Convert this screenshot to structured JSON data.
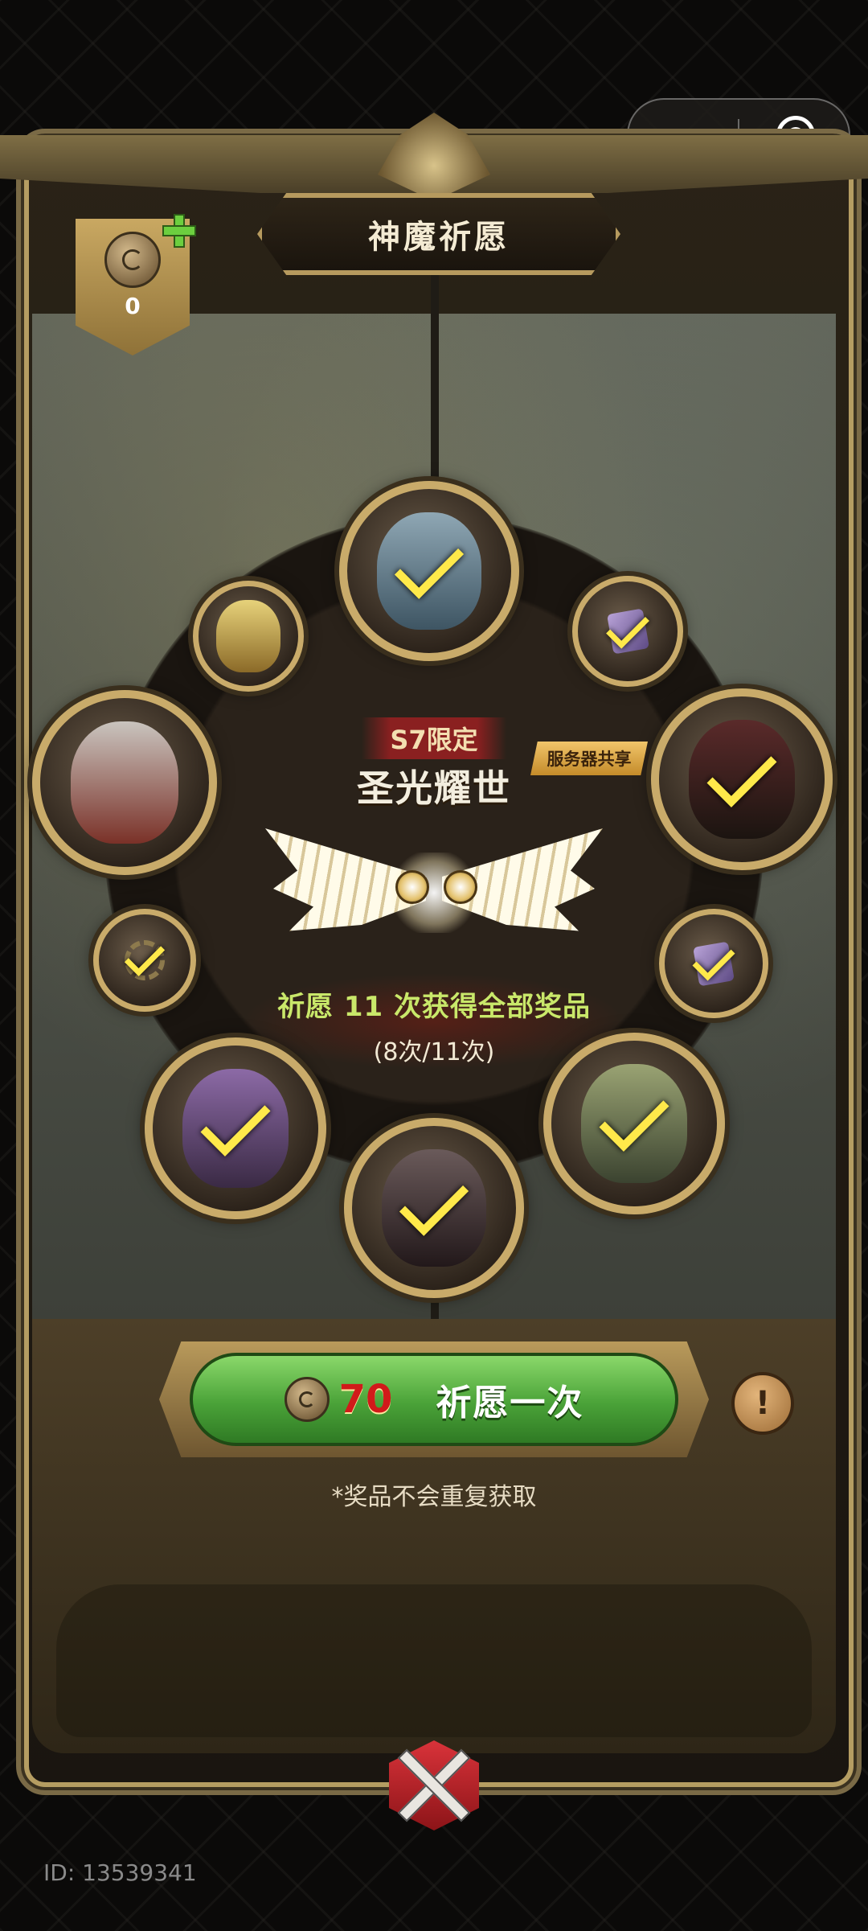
{
  "header": {
    "title": "神魔祈愿"
  },
  "currency": {
    "count": "0",
    "icon": "coin-icon",
    "add_icon": "plus-icon"
  },
  "event": {
    "limit_label": "S7限定",
    "title": "圣光耀世",
    "server_tag": "服务器共享",
    "progress_text": "祈愿 11 次获得全部奖品",
    "progress_count": "(8次/11次)",
    "progress": {
      "done": 8,
      "total": 11
    }
  },
  "rewards": [
    {
      "name": "angel-hero",
      "kind": "hero",
      "collected": true
    },
    {
      "name": "purple-cube-top",
      "kind": "item",
      "collected": true
    },
    {
      "name": "dark-demon-hero",
      "kind": "hero",
      "collected": true
    },
    {
      "name": "purple-cube-right",
      "kind": "item",
      "collected": true
    },
    {
      "name": "green-hero",
      "kind": "hero",
      "collected": true
    },
    {
      "name": "armored-hero",
      "kind": "hero",
      "collected": true
    },
    {
      "name": "purple-hair-hero",
      "kind": "hero",
      "collected": true
    },
    {
      "name": "dark-item-left",
      "kind": "item",
      "collected": true
    },
    {
      "name": "horned-hero",
      "kind": "hero",
      "collected": false
    },
    {
      "name": "golden-hero",
      "kind": "hero",
      "collected": false
    }
  ],
  "draw": {
    "cost": "70",
    "label": "祈愿一次",
    "info_label": "!"
  },
  "notice": "*奖品不会重复获取",
  "footer": {
    "user_id": "ID: 13539341"
  },
  "colors": {
    "check": "#ffe94a",
    "button_green": "#4aa238",
    "cost_red": "#d11a1a",
    "gold": "#c9ab6a"
  }
}
